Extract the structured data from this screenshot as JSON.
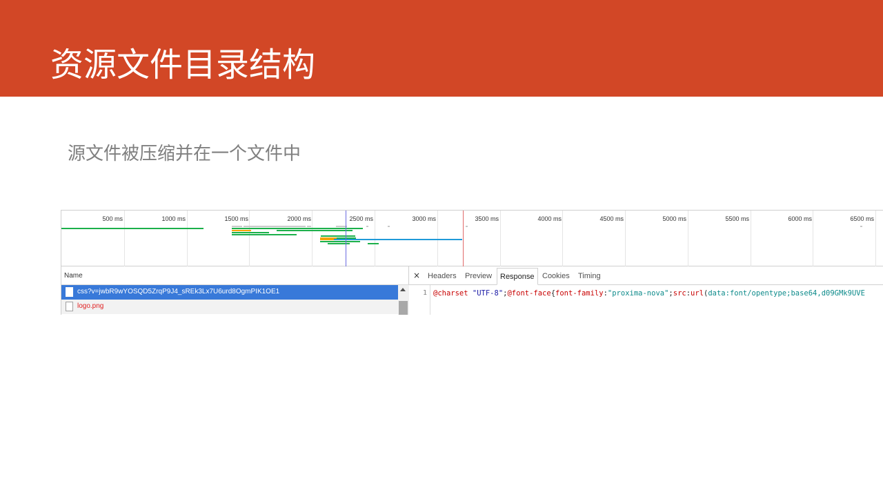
{
  "slide": {
    "title": "资源文件目录结构",
    "subtitle": "源文件被压缩并在一个文件中",
    "accent_color": "#d24726"
  },
  "timeline": {
    "ticks": [
      "500 ms",
      "1000 ms",
      "1500 ms",
      "2000 ms",
      "2500 ms",
      "3000 ms",
      "3500 ms",
      "4000 ms",
      "4500 ms",
      "5000 ms",
      "5500 ms",
      "6000 ms",
      "6500 ms"
    ]
  },
  "requests": {
    "header": "Name",
    "items": [
      {
        "name": "css?v=jwbR9wYOSQD5ZrqP9J4_sREk3Lx7U6urd8OgmPIK1OE1",
        "selected": true
      },
      {
        "name": "logo.png",
        "selected": false
      }
    ]
  },
  "detail": {
    "close_icon": "×",
    "tabs": [
      "Headers",
      "Preview",
      "Response",
      "Cookies",
      "Timing"
    ],
    "active_tab": "Response",
    "line_number": "1",
    "code": {
      "at_charset": "@charset",
      "charset_value": " \"UTF-8\"",
      "semi1": ";",
      "at_font_face": "@font-face",
      "brace": "{",
      "prop_family": "font-family",
      "colon1": ":",
      "family_value": "\"proxima-nova\"",
      "semi2": ";",
      "prop_src": "src",
      "colon2": ":",
      "url_fn": "url",
      "paren": "(",
      "data_uri": "data:font/opentype;base64,d09GMk9UVE"
    }
  }
}
